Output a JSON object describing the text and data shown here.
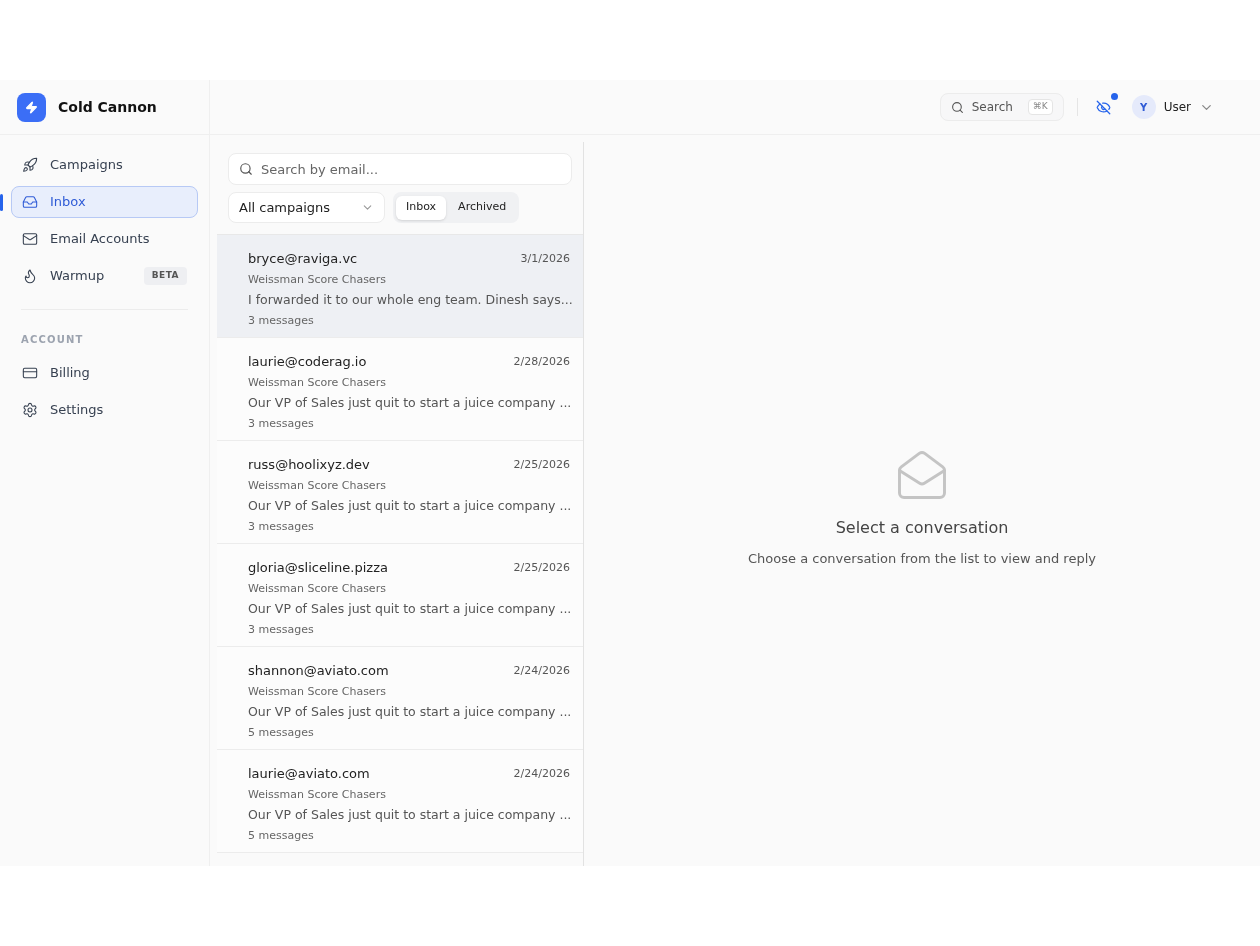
{
  "brand": {
    "name": "Cold Cannon"
  },
  "nav": [
    {
      "label": "Campaigns",
      "selected": false
    },
    {
      "label": "Inbox",
      "selected": true
    },
    {
      "label": "Email Accounts",
      "selected": false
    },
    {
      "label": "Warmup",
      "selected": false,
      "badge": "BETA"
    }
  ],
  "account_section": {
    "heading": "ACCOUNT",
    "items": [
      {
        "label": "Billing",
        "selected": false
      },
      {
        "label": "Settings",
        "selected": false
      }
    ]
  },
  "header": {
    "search": {
      "label": "Search",
      "shortcut": "⌘K"
    },
    "notification_dot": true,
    "user": {
      "initial": "Y",
      "name": "User"
    }
  },
  "list": {
    "search_placeholder": "Search by email...",
    "campaign_filter": "All campaigns",
    "tabs": [
      {
        "label": "Inbox",
        "selected": true
      },
      {
        "label": "Archived",
        "selected": false
      }
    ],
    "threads": [
      {
        "email": "bryce@raviga.vc",
        "date": "3/1/2026",
        "campaign": "Weissman Score Chasers",
        "preview": "I forwarded it to our whole eng team. Dinesh says...",
        "count": "3 messages",
        "selected": true
      },
      {
        "email": "laurie@coderag.io",
        "date": "2/28/2026",
        "campaign": "Weissman Score Chasers",
        "preview": "Our VP of Sales just quit to start a juice company ...",
        "count": "3 messages",
        "selected": false
      },
      {
        "email": "russ@hoolixyz.dev",
        "date": "2/25/2026",
        "campaign": "Weissman Score Chasers",
        "preview": "Our VP of Sales just quit to start a juice company ...",
        "count": "3 messages",
        "selected": false
      },
      {
        "email": "gloria@sliceline.pizza",
        "date": "2/25/2026",
        "campaign": "Weissman Score Chasers",
        "preview": "Our VP of Sales just quit to start a juice company ...",
        "count": "3 messages",
        "selected": false
      },
      {
        "email": "shannon@aviato.com",
        "date": "2/24/2026",
        "campaign": "Weissman Score Chasers",
        "preview": "Our VP of Sales just quit to start a juice company ...",
        "count": "5 messages",
        "selected": false
      },
      {
        "email": "laurie@aviato.com",
        "date": "2/24/2026",
        "campaign": "Weissman Score Chasers",
        "preview": "Our VP of Sales just quit to start a juice company ...",
        "count": "5 messages",
        "selected": false
      }
    ]
  },
  "empty_state": {
    "title": "Select a conversation",
    "text": "Choose a conversation from the list to view and reply"
  }
}
